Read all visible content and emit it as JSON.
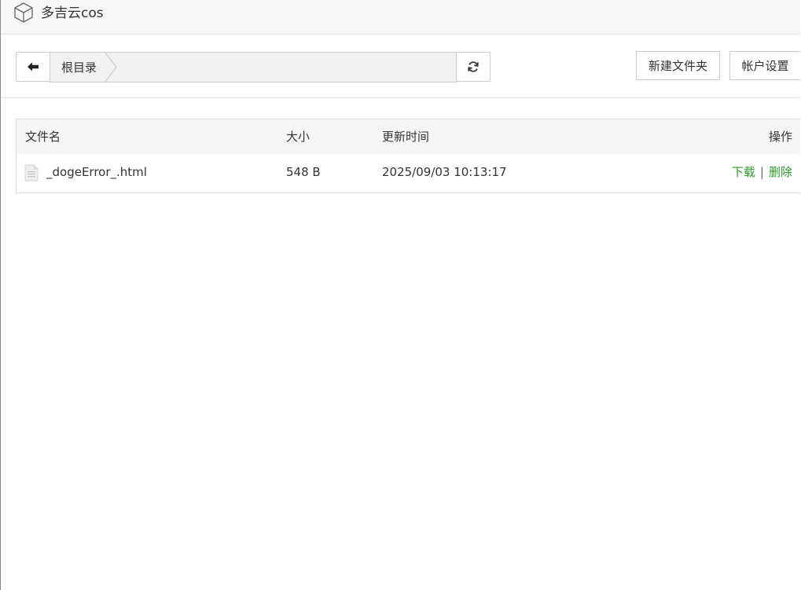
{
  "header": {
    "title": "多吉云cos",
    "logo_icon": "cube-icon"
  },
  "toolbar": {
    "back_icon": "arrow-left-icon",
    "breadcrumb": {
      "root_label": "根目录"
    },
    "refresh_icon": "refresh-icon",
    "new_folder_label": "新建文件夹",
    "account_settings_label": "帐户设置"
  },
  "table": {
    "columns": {
      "name": "文件名",
      "size": "大小",
      "updated": "更新时间",
      "actions": "操作"
    },
    "rows": [
      {
        "name": "_dogeError_.html",
        "size": "548 B",
        "updated": "2025/09/03 10:13:17",
        "download_label": "下载",
        "separator": "|",
        "delete_label": "删除",
        "icon": "file-icon"
      }
    ]
  },
  "colors": {
    "action_link": "#2a9d2a",
    "header_bg": "#f7f7f7",
    "table_head_bg": "#f5f5f5"
  }
}
